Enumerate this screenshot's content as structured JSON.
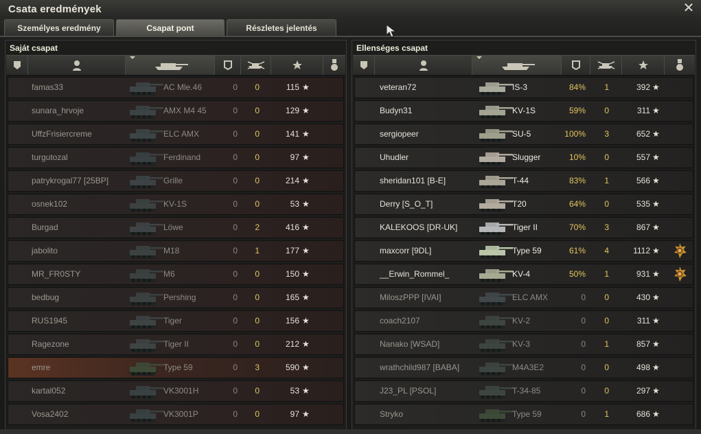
{
  "window": {
    "title": "Csata eredmények",
    "close_label": "✕"
  },
  "tabs": [
    {
      "label": "Személyes eredmény",
      "active": false
    },
    {
      "label": "Csapat pont",
      "active": true
    },
    {
      "label": "Részletes jelentés",
      "active": false
    }
  ],
  "columns": [
    "platoon-icon",
    "player-icon",
    "tank-icon",
    "damage-icon",
    "kills-icon",
    "xp-star-icon",
    "medal-icon"
  ],
  "star_glyph": "★",
  "left_team": {
    "title": "Saját csapat",
    "players": [
      {
        "name": "famas33",
        "tank": "AC Mle.46",
        "dmg": "0",
        "kills": "0",
        "xp": "115",
        "tank_color": "#3d4547"
      },
      {
        "name": "sunara_hrvoje",
        "tank": "AMX M4 45",
        "dmg": "0",
        "kills": "0",
        "xp": "129",
        "tank_color": "#3b4344"
      },
      {
        "name": "UffzFrisiercreme",
        "tank": "ELC AMX",
        "dmg": "0",
        "kills": "0",
        "xp": "141",
        "tank_color": "#3c4445"
      },
      {
        "name": "turgutozal",
        "tank": "Ferdinand",
        "dmg": "0",
        "kills": "0",
        "xp": "97",
        "tank_color": "#3a4042"
      },
      {
        "name": "patrykrogal77 [25BP]",
        "tank": "Grille",
        "dmg": "0",
        "kills": "0",
        "xp": "214",
        "tank_color": "#3d4244"
      },
      {
        "name": "osnek102",
        "tank": "KV-1S",
        "dmg": "0",
        "kills": "0",
        "xp": "53",
        "tank_color": "#3b4240"
      },
      {
        "name": "Burgad",
        "tank": "Löwe",
        "dmg": "0",
        "kills": "2",
        "xp": "416",
        "tank_color": "#3e4446"
      },
      {
        "name": "jabolito",
        "tank": "M18",
        "dmg": "0",
        "kills": "1",
        "xp": "177",
        "tank_color": "#3b4240"
      },
      {
        "name": "MR_FR0STY",
        "tank": "M6",
        "dmg": "0",
        "kills": "0",
        "xp": "150",
        "tank_color": "#3a4140"
      },
      {
        "name": "bedbug",
        "tank": "Pershing",
        "dmg": "0",
        "kills": "0",
        "xp": "165",
        "tank_color": "#3a4140"
      },
      {
        "name": "RUS1945",
        "tank": "Tiger",
        "dmg": "0",
        "kills": "0",
        "xp": "156",
        "tank_color": "#3e4344"
      },
      {
        "name": "Ragezone",
        "tank": "Tiger II",
        "dmg": "0",
        "kills": "0",
        "xp": "212",
        "tank_color": "#3e4344"
      },
      {
        "name": "emre",
        "tank": "Type 59",
        "dmg": "0",
        "kills": "3",
        "xp": "590",
        "tank_color": "#3d4a38",
        "highlight": true
      },
      {
        "name": "kartal052",
        "tank": "VK3001H",
        "dmg": "0",
        "kills": "0",
        "xp": "53",
        "tank_color": "#3a4142"
      },
      {
        "name": "Vosa2402",
        "tank": "VK3001P",
        "dmg": "0",
        "kills": "0",
        "xp": "97",
        "tank_color": "#3a4142"
      }
    ]
  },
  "right_team": {
    "title": "Ellenséges csapat",
    "players": [
      {
        "name": "veteran72",
        "tank": "IS-3",
        "dmg": "84%",
        "kills": "1",
        "xp": "392",
        "alive": true,
        "tank_color": "#a7a99a"
      },
      {
        "name": "Budyn31",
        "tank": "KV-1S",
        "dmg": "59%",
        "kills": "0",
        "xp": "311",
        "alive": true,
        "tank_color": "#a3a592"
      },
      {
        "name": "sergiopeer",
        "tank": "SU-5",
        "dmg": "100%",
        "kills": "3",
        "xp": "652",
        "alive": true,
        "tank_color": "#9fa08c"
      },
      {
        "name": "Uhudler",
        "tank": "Slugger",
        "dmg": "10%",
        "kills": "0",
        "xp": "557",
        "alive": true,
        "tank_color": "#b1aaa0"
      },
      {
        "name": "sheridan101 [B-E]",
        "tank": "T-44",
        "dmg": "83%",
        "kills": "1",
        "xp": "566",
        "alive": true,
        "tank_color": "#a9a597"
      },
      {
        "name": "Derry [S_O_T]",
        "tank": "T20",
        "dmg": "64%",
        "kills": "0",
        "xp": "535",
        "alive": true,
        "tank_color": "#b3ab9e"
      },
      {
        "name": "KALEKOOS [DR-UK]",
        "tank": "Tiger II",
        "dmg": "70%",
        "kills": "3",
        "xp": "867",
        "alive": true,
        "tank_color": "#b4b6b8"
      },
      {
        "name": "maxcorr [9DL]",
        "tank": "Type 59",
        "dmg": "61%",
        "kills": "4",
        "xp": "1112",
        "alive": true,
        "medal": true,
        "tank_color": "#b9c6a8"
      },
      {
        "name": "__Erwin_Rommel_",
        "tank": "KV-4",
        "dmg": "50%",
        "kills": "1",
        "xp": "931",
        "alive": true,
        "medal": true,
        "tank_color": "#a6aa92"
      },
      {
        "name": "MiloszPPP [IVAI]",
        "tank": "ELC AMX",
        "dmg": "0",
        "kills": "0",
        "xp": "430",
        "alive": false,
        "tank_color": "#40484a"
      },
      {
        "name": "coach2107",
        "tank": "KV-2",
        "dmg": "0",
        "kills": "0",
        "xp": "311",
        "alive": false,
        "tank_color": "#3d4541"
      },
      {
        "name": "Nanako [WSAD]",
        "tank": "KV-3",
        "dmg": "0",
        "kills": "1",
        "xp": "857",
        "alive": false,
        "tank_color": "#3d4541"
      },
      {
        "name": "wrathchild987 [BABA]",
        "tank": "M4A3E2",
        "dmg": "0",
        "kills": "0",
        "xp": "498",
        "alive": false,
        "tank_color": "#3d4541"
      },
      {
        "name": "J23_PL [PSOL]",
        "tank": "T-34-85",
        "dmg": "0",
        "kills": "0",
        "xp": "297",
        "alive": false,
        "tank_color": "#3d4541"
      },
      {
        "name": "Stryko",
        "tank": "Type 59",
        "dmg": "0",
        "kills": "1",
        "xp": "686",
        "alive": false,
        "tank_color": "#3d4a38"
      }
    ]
  }
}
